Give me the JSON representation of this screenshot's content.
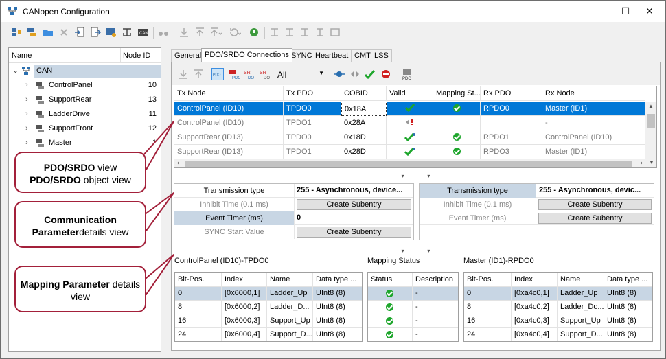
{
  "window": {
    "title": "CANopen Configuration",
    "min": "—",
    "max": "☐",
    "close": "✕"
  },
  "colors": {
    "selection": "#0078d7",
    "highlight": "#c8d6e4",
    "callout_border": "#a3203a",
    "ok": "#1ea62c"
  },
  "toolbar_icons": [
    "add-node-icon",
    "add-node-2-icon",
    "folder-icon",
    "delete-icon",
    "import-icon",
    "export-icon",
    "network-scan-icon",
    "network-icon",
    "can-device-icon",
    "binoculars-icon",
    "download-icon",
    "upload-icon",
    "upload-dropdown-icon",
    "refresh-dropdown-icon",
    "nmt-icon",
    "node-a-icon",
    "node-b-icon",
    "node-c-icon",
    "node-d-icon",
    "node-e-icon"
  ],
  "tree": {
    "headers": {
      "name": "Name",
      "node_id": "Node ID"
    },
    "root": "CAN",
    "items": [
      {
        "label": "ControlPanel",
        "id": "10"
      },
      {
        "label": "SupportRear",
        "id": "13"
      },
      {
        "label": "LadderDrive",
        "id": "11"
      },
      {
        "label": "SupportFront",
        "id": "12"
      },
      {
        "label": "Master",
        "id": "1"
      }
    ]
  },
  "tabs": [
    "General",
    "PDO/SRDO Connections",
    "SYNC",
    "Heartbeat",
    "CMT",
    "LSS"
  ],
  "pdo_toolbar": {
    "filter": "All"
  },
  "pdo_grid": {
    "headers": [
      "Tx Node",
      "Tx PDO",
      "COBID",
      "Valid",
      "Mapping St...",
      "Rx PDO",
      "Rx Node"
    ],
    "rows": [
      {
        "tx_node": "ControlPanel (ID10)",
        "tx_pdo": "TPDO0",
        "cobid": "0x18A",
        "rx_pdo": "RPDO0",
        "rx_node": "Master (ID1)"
      },
      {
        "tx_node": "ControlPanel (ID10)",
        "tx_pdo": "TPDO1",
        "cobid": "0x28A",
        "rx_pdo": "",
        "rx_node": "-"
      },
      {
        "tx_node": "SupportRear (ID13)",
        "tx_pdo": "TPDO0",
        "cobid": "0x18D",
        "rx_pdo": "RPDO1",
        "rx_node": "ControlPanel (ID10)"
      },
      {
        "tx_node": "SupportRear (ID13)",
        "tx_pdo": "TPDO1",
        "cobid": "0x28D",
        "rx_pdo": "RPDO3",
        "rx_node": "Master (ID1)"
      }
    ]
  },
  "comm_tx": {
    "transmission_type_label": "Transmission type",
    "transmission_type_value": "255 - Asynchronous, device...",
    "inhibit_label": "Inhibit Time (0.1 ms)",
    "inhibit_button": "Create Subentry",
    "event_label": "Event Timer (ms)",
    "event_value": "0",
    "sync_label": "SYNC Start Value",
    "sync_button": "Create Subentry"
  },
  "comm_rx": {
    "transmission_type_label": "Transmission type",
    "transmission_type_value": "255 - Asynchronous, devic...",
    "inhibit_label": "Inhibit Time (0.1 ms)",
    "inhibit_button": "Create Subentry",
    "event_label": "Event Timer (ms)",
    "event_button": "Create Subentry"
  },
  "mapping": {
    "tx_title": "ControlPanel (ID10)-TPDO0",
    "status_title": "Mapping Status",
    "rx_title": "Master (ID1)-RPDO0",
    "tx_headers": [
      "Bit-Pos.",
      "Index",
      "Name",
      "Data type ..."
    ],
    "tx_rows": [
      [
        "0",
        "[0x6000,1]",
        "Ladder_Up",
        "UInt8 (8)"
      ],
      [
        "8",
        "[0x6000,2]",
        "Ladder_D...",
        "UInt8 (8)"
      ],
      [
        "16",
        "[0x6000,3]",
        "Support_Up",
        "UInt8 (8)"
      ],
      [
        "24",
        "[0x6000,4]",
        "Support_D...",
        "UInt8 (8)"
      ]
    ],
    "status_headers": [
      "Status",
      "Description"
    ],
    "status_desc": [
      "-",
      "-",
      "-",
      "-"
    ],
    "rx_headers": [
      "Bit-Pos.",
      "Index",
      "Name",
      "Data type ..."
    ],
    "rx_rows": [
      [
        "0",
        "[0xa4c0,1]",
        "Ladder_Up",
        "UInt8 (8)"
      ],
      [
        "8",
        "[0xa4c0,2]",
        "Ladder_Do...",
        "UInt8 (8)"
      ],
      [
        "16",
        "[0xa4c0,3]",
        "Support_Up",
        "UInt8 (8)"
      ],
      [
        "24",
        "[0xa4c0,4]",
        "Support_D...",
        "UInt8 (8)"
      ]
    ]
  },
  "callouts": {
    "c1_bold1": "PDO/SRDO",
    "c1_t1": " view",
    "c1_bold2": "PDO/SRDO",
    "c1_t2": " object view",
    "c2_bold1": "Communication",
    "c2_bold2": "Parameter",
    "c2_t2": "details view",
    "c3_bold1": "Mapping Parameter",
    "c3_t1": " details",
    "c3_t2": "view"
  }
}
